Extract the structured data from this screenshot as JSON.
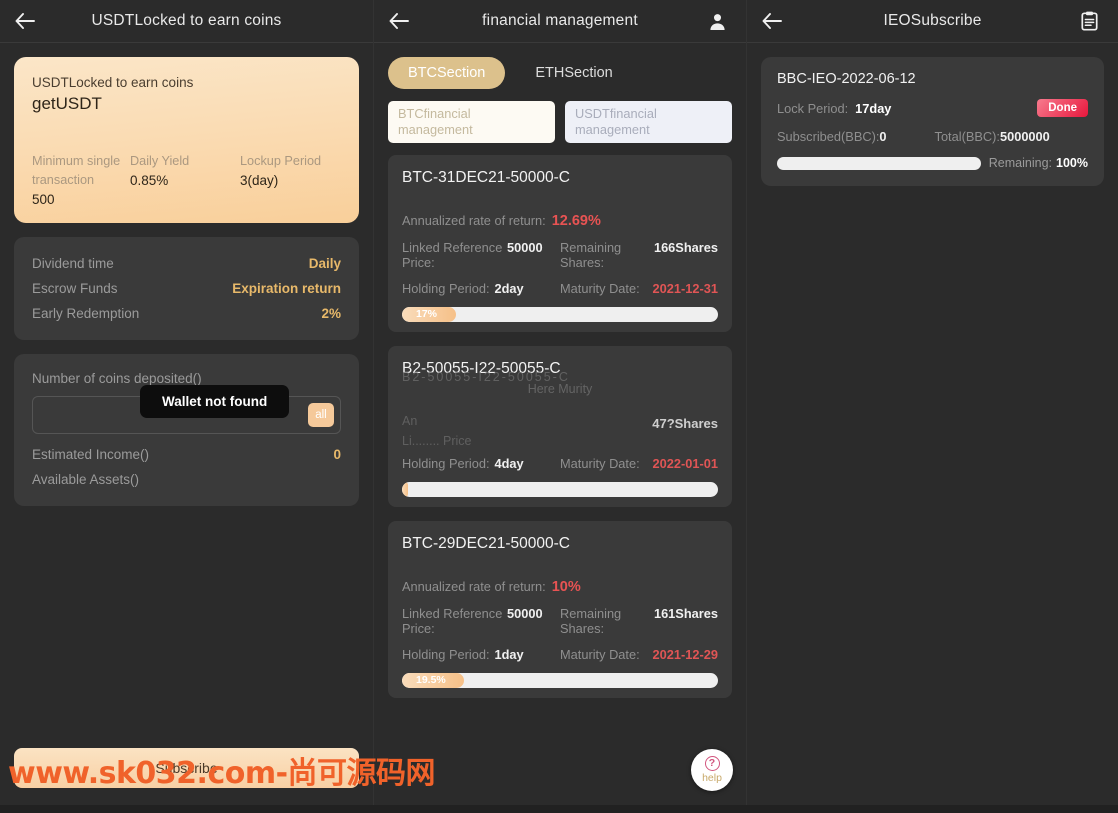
{
  "panels": {
    "left": {
      "header": {
        "title": "USDTLocked to earn coins",
        "back_icon": "arrow-left-icon"
      },
      "hero": {
        "subtitle": "USDTLocked to earn coins",
        "title": "getUSDT",
        "stats": [
          {
            "key": "Minimum single transaction",
            "value": "500"
          },
          {
            "key": "Daily Yield",
            "value": "0.85%"
          },
          {
            "key": "Lockup Period",
            "value": "3(day)"
          }
        ]
      },
      "terms": [
        {
          "key": "Dividend time",
          "value": "Daily"
        },
        {
          "key": "Escrow Funds",
          "value": "Expiration return"
        },
        {
          "key": "Early Redemption",
          "value": "2%"
        }
      ],
      "deposit": {
        "label": "Number of coins deposited()",
        "input_value": "",
        "input_placeholder": "",
        "all_button": "all",
        "tooltip": "Wallet not found",
        "estimated_income_label": "Estimated Income()",
        "estimated_income_value": "0",
        "available_assets_label": "Available Assets()",
        "available_assets_value": ""
      },
      "subscribe_button": "Subscribe"
    },
    "mid": {
      "header": {
        "title": "financial management",
        "back_icon": "arrow-left-icon",
        "account_icon": "user-icon"
      },
      "segments": [
        {
          "label": "BTCSection",
          "active": true
        },
        {
          "label": "ETHSection",
          "active": false
        }
      ],
      "fin_tabs": [
        {
          "label": "BTCfinancial management",
          "style": "warm"
        },
        {
          "label": "USDTfinancial management",
          "style": "cool"
        }
      ],
      "labels": {
        "annualized": "Annualized rate of return:",
        "linked_price": "Linked Reference Price:",
        "remaining_shares": "Remaining Shares:",
        "holding_period": "Holding Period:",
        "maturity_date": "Maturity Date:"
      },
      "products": [
        {
          "name": "BTC-31DEC21-50000-C",
          "annualized": "12.69%",
          "linked_price": "50000",
          "remaining_shares": "166Shares",
          "holding_period": "2day",
          "maturity_date": "2021-12-31",
          "progress_text": "17%",
          "progress_pct": 17,
          "glitched": false
        },
        {
          "name": "B2-50055-I22-50055-C",
          "annualized": "",
          "linked_price": "",
          "remaining_shares": "47?Shares",
          "holding_period": "4day",
          "maturity_date": "2022-01-01",
          "progress_text": "",
          "progress_pct": 2,
          "glitched": true,
          "ghost_lines": [
            "B2-50055-I22-50055-C",
            "Here    Murity",
            "An",
            "Li........   Price"
          ]
        },
        {
          "name": "BTC-29DEC21-50000-C",
          "annualized": "10%",
          "linked_price": "50000",
          "remaining_shares": "161Shares",
          "holding_period": "1day",
          "maturity_date": "2021-12-29",
          "progress_text": "19.5%",
          "progress_pct": 19.5,
          "glitched": false
        }
      ],
      "help": {
        "label": "help",
        "icon": "question-mark-icon"
      }
    },
    "right": {
      "header": {
        "title": "IEOSubscribe",
        "back_icon": "arrow-left-icon",
        "records_icon": "clipboard-icon"
      },
      "item": {
        "name": "BBC-IEO-2022-06-12",
        "lock_period_label": "Lock Period:",
        "lock_period_value": "17day",
        "status_badge": "Done",
        "subscribed_label": "Subscribed(BBC):",
        "subscribed_value": "0",
        "total_label": "Total(BBC):",
        "total_value": "5000000",
        "remaining_label": "Remaining:",
        "remaining_value": "100%",
        "progress_pct": 100
      }
    }
  },
  "watermark": "www.sk032.com-尚可源码网",
  "colors": {
    "background": "#2b2b2b",
    "card": "#3a3a3a",
    "accent_warm": "#e8b96a",
    "accent_red": "#e85353",
    "badge_red": "#e8173c",
    "watermark_orange": "#f0622a"
  }
}
